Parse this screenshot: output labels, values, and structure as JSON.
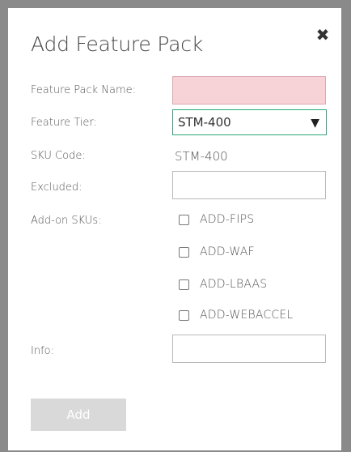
{
  "dialog": {
    "title": "Add Feature Pack",
    "close_symbol": "✖"
  },
  "form": {
    "feature_pack_name": {
      "label": "Feature Pack Name:",
      "value": ""
    },
    "feature_tier": {
      "label": "Feature Tier:",
      "selected": "STM-400",
      "arrow": "▼"
    },
    "sku_code": {
      "label": "SKU Code:",
      "value": "STM-400"
    },
    "excluded": {
      "label": "Excluded:",
      "value": ""
    },
    "add_on_skus": {
      "label": "Add-on SKUs:",
      "options": [
        "ADD-FIPS",
        "ADD-WAF",
        "ADD-LBAAS",
        "ADD-WEBACCEL"
      ]
    },
    "info": {
      "label": "Info:",
      "value": ""
    }
  },
  "actions": {
    "add_label": "Add"
  },
  "colors": {
    "invalid_field_bg": "#f7d3d8",
    "select_border": "#2aa878",
    "disabled_button_bg": "#d9d9d9"
  }
}
